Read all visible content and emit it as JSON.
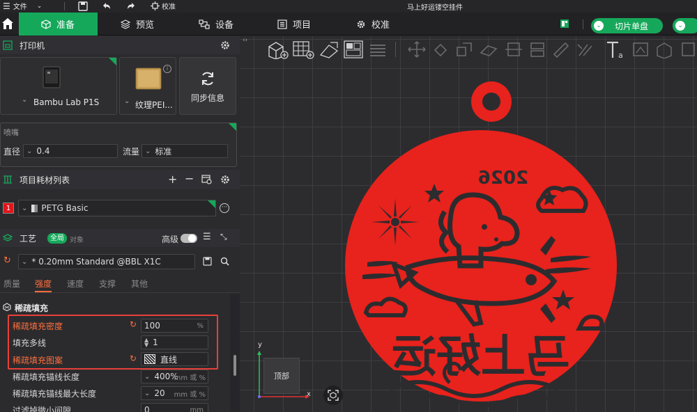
{
  "titlebar": {
    "menu_label": "文件",
    "calibrate_label": "校准",
    "window_title": "马上好运镂空挂件"
  },
  "nav": {
    "prepare": "准备",
    "preview": "预览",
    "device": "设备",
    "project": "项目",
    "calibrate": "校准",
    "slice_label": "切片单盘"
  },
  "printer": {
    "header": "打印机",
    "printer_name": "Bambu Lab P1S",
    "plate_name": "纹理PEI...",
    "sync_label": "同步信息"
  },
  "nozzle": {
    "header": "喷嘴",
    "diameter_label": "直径",
    "diameter_value": "0.4",
    "flow_label": "流量",
    "flow_value": "标准"
  },
  "filament": {
    "header": "项目耗材列表",
    "slot_number": "1",
    "slot_color": "#e0161b",
    "name": "PETG Basic"
  },
  "process": {
    "header": "工艺",
    "toggle_global": "全局",
    "toggle_object": "对象",
    "advanced_label": "高级",
    "preset": "* 0.20mm Standard @BBL X1C",
    "tabs": [
      "质量",
      "强度",
      "速度",
      "支撑",
      "其他"
    ],
    "active_tab": "强度"
  },
  "infill": {
    "header": "稀疏填充",
    "rows": [
      {
        "label": "稀疏填充密度",
        "value": "100",
        "unit": "%"
      },
      {
        "label": "填充多线",
        "value": "1",
        "unit": ""
      },
      {
        "label": "稀疏填充图案",
        "value": "直线",
        "unit": ""
      },
      {
        "label": "稀疏填充锚线长度",
        "value": "400%",
        "unit": "mm 或 %"
      },
      {
        "label": "稀疏填充锚线最大长度",
        "value": "20",
        "unit": "mm 或 %"
      },
      {
        "label": "过滤掉微小间隙",
        "value": "0",
        "unit": "mm"
      }
    ]
  },
  "viewport": {
    "ornament_year": "2026",
    "ornament_text": "马上好运",
    "ornament_color": "#e8221c",
    "view_cube_label": "顶部",
    "axis_y": "y",
    "axis_x": "x"
  },
  "colors": {
    "accent": "#16a85a",
    "highlight": "#ff6f3d"
  }
}
